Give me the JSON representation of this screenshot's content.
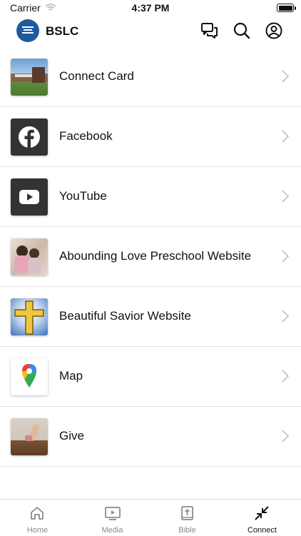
{
  "status_bar": {
    "carrier": "Carrier",
    "time": "4:37 PM"
  },
  "header": {
    "title": "BSLC"
  },
  "list": [
    {
      "label": "Connect Card",
      "thumb": "church-building-photo"
    },
    {
      "label": "Facebook",
      "thumb": "facebook-icon"
    },
    {
      "label": "YouTube",
      "thumb": "youtube-icon"
    },
    {
      "label": "Abounding Love Preschool Website",
      "thumb": "preschool-children-photo"
    },
    {
      "label": "Beautiful Savior Website",
      "thumb": "cross-icon"
    },
    {
      "label": "Map",
      "thumb": "map-pin-icon"
    },
    {
      "label": "Give",
      "thumb": "giving-photo"
    }
  ],
  "tabs": [
    {
      "label": "Home",
      "icon": "home-icon",
      "active": false
    },
    {
      "label": "Media",
      "icon": "media-icon",
      "active": false
    },
    {
      "label": "Bible",
      "icon": "bible-icon",
      "active": false
    },
    {
      "label": "Connect",
      "icon": "connect-icon",
      "active": true
    }
  ],
  "colors": {
    "brand_blue": "#1f5aa0",
    "divider": "#e3e3e3",
    "inactive_tab": "#8a8a8a"
  }
}
